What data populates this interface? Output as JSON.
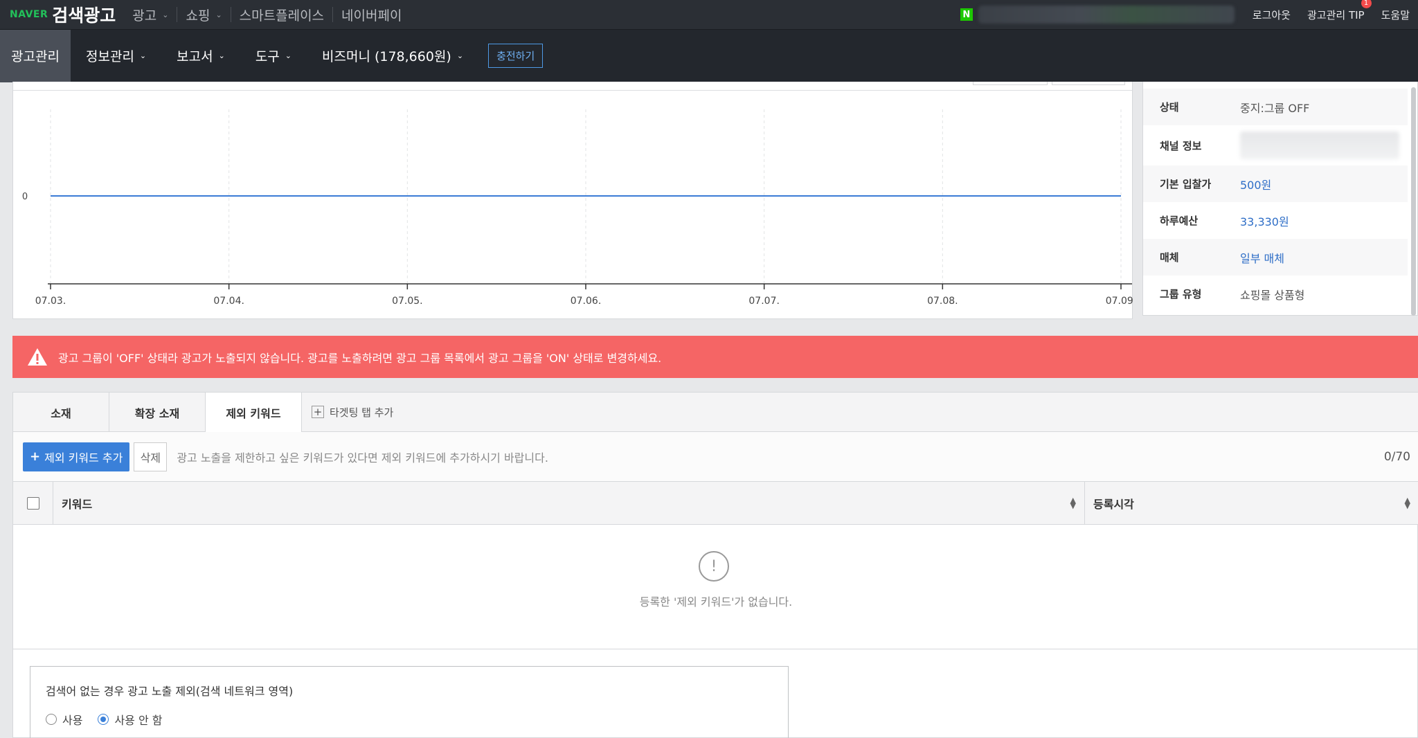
{
  "topbar": {
    "brand_naver": "NAVER",
    "brand_title": "검색광고",
    "nav": [
      {
        "label": "광고",
        "chevron": true
      },
      {
        "label": "쇼핑",
        "chevron": true
      },
      {
        "label": "스마트플레이스",
        "chevron": false
      },
      {
        "label": "네이버페이",
        "chevron": false
      }
    ],
    "n_badge": "N",
    "logout": "로그아웃",
    "tip": "광고관리 TIP",
    "tip_badge": "1",
    "help": "도움말"
  },
  "subnav": {
    "items": [
      "광고관리",
      "정보관리",
      "보고서",
      "도구",
      "비즈머니 (178,660원)"
    ],
    "charge": "충전하기"
  },
  "chart_data": {
    "type": "line",
    "x": [
      "07.03.",
      "07.04.",
      "07.05.",
      "07.06.",
      "07.07.",
      "07.08.",
      "07.09."
    ],
    "series": [
      {
        "values": [
          0,
          0,
          0,
          0,
          0,
          0,
          0
        ],
        "color": "#3a7bd5"
      }
    ],
    "y_tick": "0",
    "grid": "vertical-dashed"
  },
  "info": {
    "rows": [
      {
        "label": "상태",
        "value": "중지:그룹 OFF",
        "link": false
      },
      {
        "label": "채널 정보",
        "value": "",
        "link": false
      },
      {
        "label": "기본 입찰가",
        "value": "500원",
        "link": true
      },
      {
        "label": "하루예산",
        "value": "33,330원",
        "link": true
      },
      {
        "label": "매체",
        "value": "일부 매체",
        "link": true
      },
      {
        "label": "그룹 유형",
        "value": "쇼핑몰 상품형",
        "link": false
      }
    ]
  },
  "warning": {
    "text": "광고 그룹이 'OFF' 상태라 광고가 노출되지 않습니다. 광고를 노출하려면 광고 그룹 목록에서 광고 그룹을 'ON' 상태로 변경하세요."
  },
  "tabs": {
    "items": [
      "소재",
      "확장 소재",
      "제외 키워드"
    ],
    "active": "제외 키워드",
    "add_label": "타겟팅 탭 추가"
  },
  "toolbar": {
    "add_button": "제외 키워드 추가",
    "delete_button": "삭제",
    "hint": "광고 노출을 제한하고 싶은 키워드가 있다면 제외 키워드에 추가하시기 바랍니다.",
    "count": "0/70"
  },
  "table": {
    "columns": [
      "키워드",
      "등록시각"
    ],
    "empty_text": "등록한 '제외 키워드'가 없습니다."
  },
  "option": {
    "title": "검색어 없는 경우 광고 노출 제외(검색 네트워크 영역)",
    "choices": [
      "사용",
      "사용 안 함"
    ],
    "selected": "사용 안 함"
  },
  "colors": {
    "topbar_bg": "#2b2f35",
    "subnav_bg": "#23272d",
    "warning_bg": "#f56565",
    "accent_blue": "#3a80d9",
    "naver_green": "#22c15a"
  }
}
